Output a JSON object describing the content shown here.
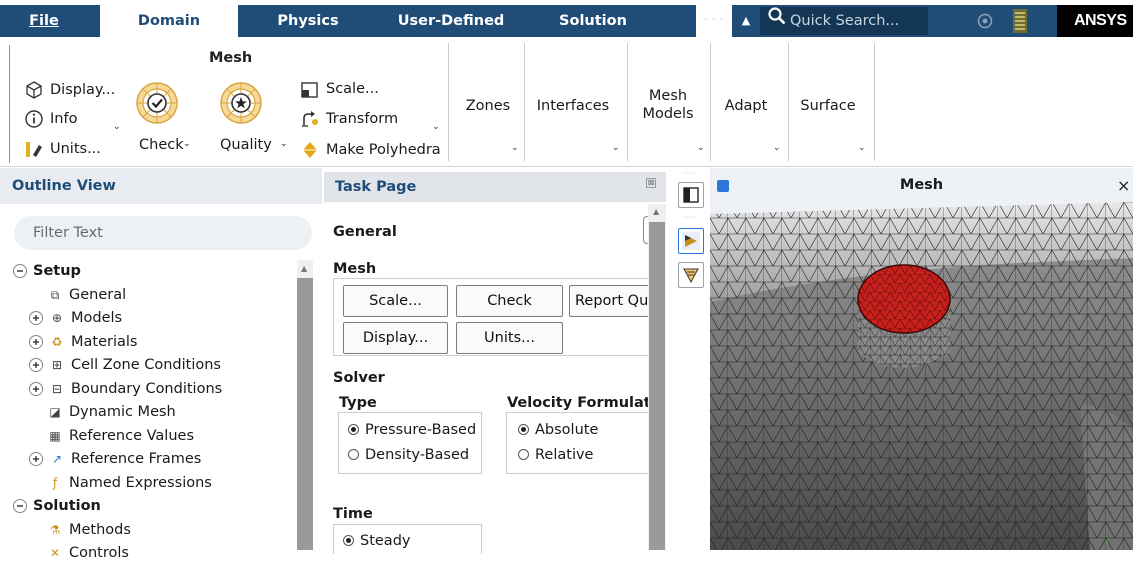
{
  "menubar": {
    "tabs": [
      "File",
      "Domain",
      "Physics",
      "User-Defined",
      "Solution"
    ],
    "active_tab": "Domain",
    "search_placeholder": "Quick Search...",
    "logo": "ANSYS"
  },
  "ribbon": {
    "mesh_group": {
      "title": "Mesh",
      "display": "Display...",
      "info": "Info",
      "units": "Units...",
      "check": "Check",
      "quality": "Quality",
      "scale": "Scale...",
      "transform": "Transform",
      "make_polyhedra": "Make Polyhedra"
    },
    "zones": "Zones",
    "interfaces": "Interfaces",
    "mesh_models": [
      "Mesh",
      "Models"
    ],
    "adapt": "Adapt",
    "surface": "Surface"
  },
  "outline": {
    "title": "Outline View",
    "filter_placeholder": "Filter Text",
    "tree": [
      {
        "label": "Setup",
        "level": 0,
        "bold": true,
        "expander": "minus",
        "icon": ""
      },
      {
        "label": "General",
        "level": 1,
        "icon": "general-icon"
      },
      {
        "label": "Models",
        "level": 1,
        "expander": "plus",
        "icon": "models-icon"
      },
      {
        "label": "Materials",
        "level": 1,
        "expander": "plus",
        "icon": "materials-icon"
      },
      {
        "label": "Cell Zone Conditions",
        "level": 1,
        "expander": "plus",
        "icon": "cell-zone-icon"
      },
      {
        "label": "Boundary Conditions",
        "level": 1,
        "expander": "plus",
        "icon": "boundary-icon"
      },
      {
        "label": "Dynamic Mesh",
        "level": 1,
        "icon": "dynamic-mesh-icon"
      },
      {
        "label": "Reference Values",
        "level": 1,
        "icon": "reference-values-icon"
      },
      {
        "label": "Reference Frames",
        "level": 1,
        "expander": "plus",
        "icon": "reference-frames-icon"
      },
      {
        "label": "Named Expressions",
        "level": 1,
        "icon": "named-expressions-icon"
      },
      {
        "label": "Solution",
        "level": 0,
        "bold": true,
        "expander": "minus",
        "icon": ""
      },
      {
        "label": "Methods",
        "level": 1,
        "icon": "methods-icon"
      },
      {
        "label": "Controls",
        "level": 1,
        "icon": "controls-icon"
      }
    ]
  },
  "task_page": {
    "title": "Task Page",
    "section": "General",
    "mesh_label": "Mesh",
    "buttons": {
      "scale": "Scale...",
      "check": "Check",
      "report_quality": "Report Qua",
      "display": "Display...",
      "units": "Units..."
    },
    "solver_label": "Solver",
    "type_label": "Type",
    "type_options": [
      "Pressure-Based",
      "Density-Based"
    ],
    "type_selected": "Pressure-Based",
    "velocity_label": "Velocity Formulati",
    "velocity_options": [
      "Absolute",
      "Relative"
    ],
    "velocity_selected": "Absolute",
    "time_label": "Time",
    "time_options": [
      "Steady"
    ],
    "time_selected": "Steady"
  },
  "graphics": {
    "title": "Mesh",
    "close": "×"
  },
  "colors": {
    "menubar": "#1f4d78",
    "accent_blue": "#1f4d78",
    "mesh_red": "#c8201c",
    "mesh_gray": "#5c5c5c",
    "background": "#eef2f6"
  }
}
